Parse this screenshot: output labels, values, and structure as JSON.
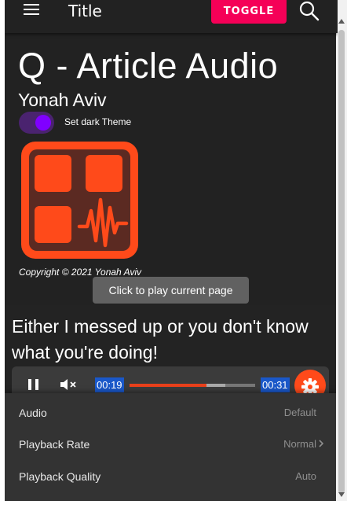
{
  "appbar": {
    "title": "Title",
    "toggle_label": "TOGGLE",
    "menu_icon": "hamburger-menu-icon",
    "search_icon": "search-icon",
    "toggle_color": "#f50057"
  },
  "header": {
    "title": "Q - Article Audio",
    "author": "Yonah Aviv",
    "theme_switch_label": "Set dark Theme",
    "theme_switch_on": true,
    "copyright": "Copyright © 2021 Yonah Aviv"
  },
  "tooltip": {
    "text": "Click to play current page"
  },
  "article": {
    "text": "Either I messed up or you don't know what you're doing!"
  },
  "player": {
    "current_time": "00:19",
    "total_time": "00:31",
    "progress_fraction": 0.61,
    "buffered_fraction": 0.76,
    "pause_icon": "pause-icon",
    "mute_icon": "volume-muted-icon",
    "settings_icon": "gear-icon",
    "accent_color": "#ff4a1a"
  },
  "settings_menu": {
    "items": [
      {
        "label": "Audio",
        "value": "Default"
      },
      {
        "label": "Playback Rate",
        "value": "Normal"
      },
      {
        "label": "Playback Quality",
        "value": "Auto"
      }
    ]
  }
}
